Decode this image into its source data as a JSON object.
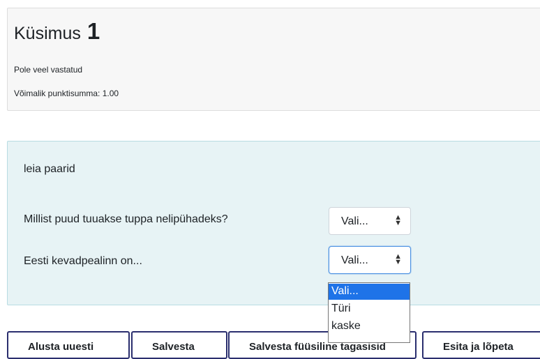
{
  "question": {
    "label": "Küsimus",
    "number": "1",
    "state": "Pole veel vastatud",
    "grade": "Võimalik punktisumma: 1.00"
  },
  "content": {
    "question_text": "leia paarid",
    "rows": [
      {
        "label": "Millist puud tuuakse tuppa nelipühadeks?",
        "selected": "Vali..."
      },
      {
        "label": "Eesti kevadpealinn on...",
        "selected": "Vali..."
      }
    ],
    "select_arrows": {
      "up": "▲",
      "down": "▼"
    },
    "dropdown_options": [
      "Vali...",
      "Türi",
      "kaske"
    ]
  },
  "buttons": [
    "Alusta uuesti",
    "Salvesta",
    "Salvesta füüsiline tagasisid",
    "Esita ja lõpeta"
  ],
  "colors": {
    "info_bg": "#f7f7f7",
    "content_bg": "#e7f3f5",
    "option_highlight": "#1e73e8",
    "button_border": "#2a2e6e"
  }
}
